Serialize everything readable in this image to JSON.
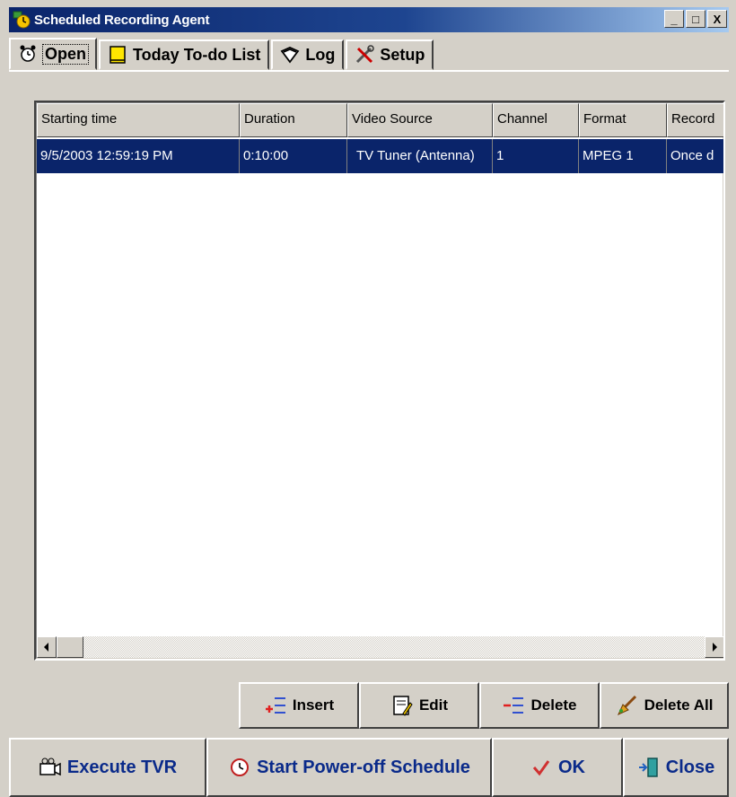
{
  "window": {
    "title": "Scheduled Recording Agent",
    "controls": {
      "minimize": "_",
      "maximize": "□",
      "close": "X"
    }
  },
  "tabs": [
    {
      "label": "Open",
      "icon": "alarm-clock-icon",
      "active": true
    },
    {
      "label": "Today To-do List",
      "icon": "notepad-icon",
      "active": false
    },
    {
      "label": "Log",
      "icon": "book-icon",
      "active": false
    },
    {
      "label": "Setup",
      "icon": "tools-icon",
      "active": false
    }
  ],
  "schedule_table": {
    "columns": [
      "Starting time",
      "Duration",
      "Video Source",
      "Channel",
      "Format",
      "Record"
    ],
    "rows": [
      {
        "starting_time": "9/5/2003 12:59:19 PM",
        "duration": "0:10:00",
        "video_source": "TV Tuner (Antenna)",
        "channel": "1",
        "format": "MPEG 1",
        "record": "Once d",
        "selected": true
      }
    ]
  },
  "list_actions": {
    "insert": "Insert",
    "edit": "Edit",
    "delete": "Delete",
    "delete_all": "Delete All"
  },
  "footer": {
    "execute_tvr": "Execute TVR",
    "start_power_off": "Start Power-off Schedule",
    "ok": "OK",
    "close": "Close"
  },
  "colors": {
    "window_face": "#d4d0c8",
    "title_gradient_start": "#0a246a",
    "title_gradient_end": "#a6caf0",
    "selection": "#0a246a",
    "footer_text": "#0a2a8a"
  }
}
